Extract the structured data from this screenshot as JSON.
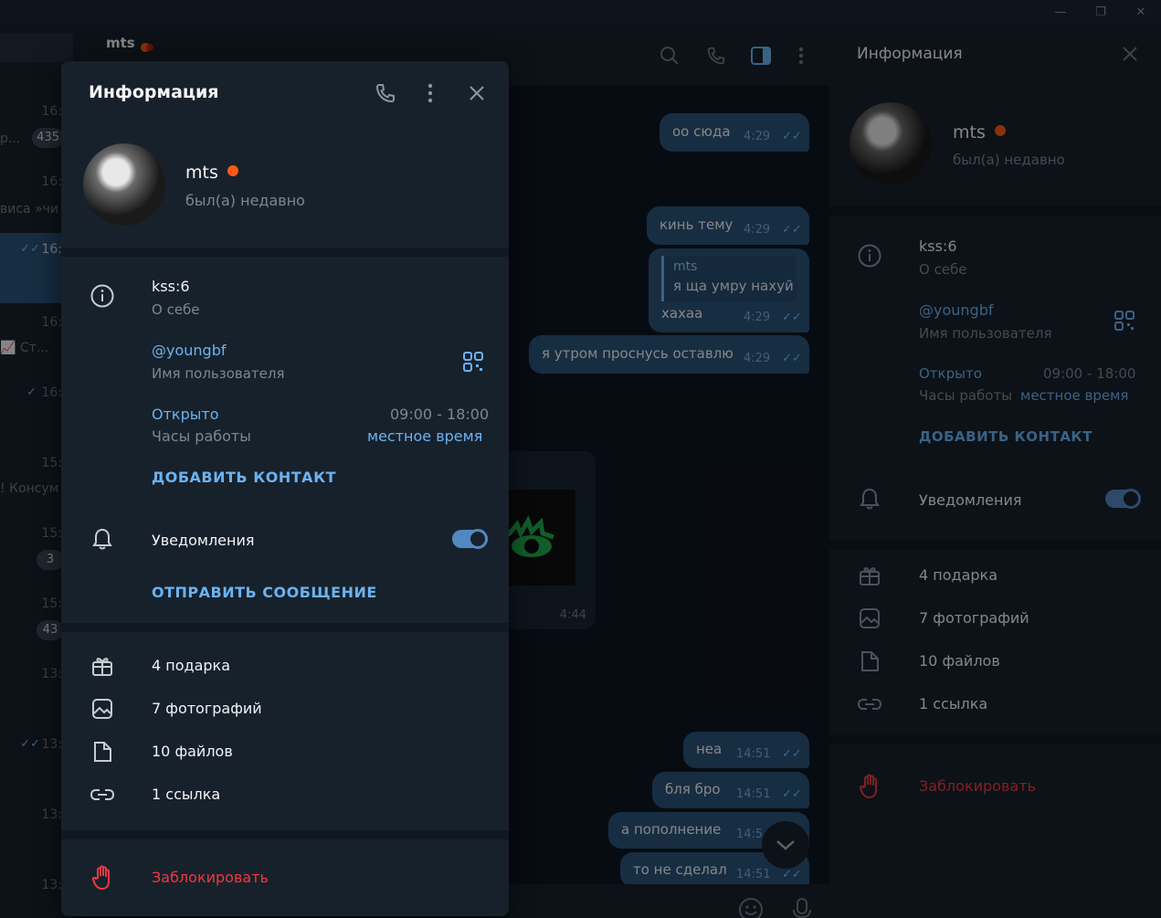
{
  "chat_list": {
    "rows": [
      {
        "time": "16:",
        "preview": "р...",
        "badge": "435"
      },
      {
        "time": "16:",
        "preview": "виса »чи",
        "badge": ""
      },
      {
        "time": "16:",
        "preview": "",
        "badge": ""
      },
      {
        "time": "16:",
        "preview": "📈 Ст...",
        "badge": ""
      },
      {
        "time": "16:",
        "preview": "",
        "badge": ""
      },
      {
        "time": "15:",
        "preview": "! Консум",
        "badge": ""
      },
      {
        "time": "15:",
        "preview": "",
        "badge": "3"
      },
      {
        "time": "15:",
        "preview": "",
        "badge": "43"
      },
      {
        "time": "13:",
        "preview": "",
        "badge": ""
      },
      {
        "time": "13:",
        "preview": "",
        "badge": ""
      },
      {
        "time": "13:",
        "preview": "",
        "badge": ""
      },
      {
        "time": "13:",
        "preview": "",
        "badge": ""
      }
    ]
  },
  "chat": {
    "title": "mts",
    "messages": [
      {
        "text": "оо сюда",
        "time": "4:29"
      },
      {
        "text": "кинь тему",
        "time": "4:29"
      },
      {
        "reply_name": "mts",
        "reply_text": "я ща умру нахуй",
        "text": "хахаа",
        "time": "4:29"
      },
      {
        "text": "я утром проснусь оставлю",
        "time": "4:29"
      },
      {
        "image_time": "4:44"
      },
      {
        "text": "неа",
        "time": "14:51"
      },
      {
        "text": "бля бро",
        "time": "14:51"
      },
      {
        "text": "а пополнение",
        "time": "14:5"
      },
      {
        "text": "то не сделал",
        "time": "14:51"
      }
    ]
  },
  "info": {
    "header": "Информация",
    "name": "mts",
    "status": "был(а) недавно",
    "bio": "kss:6",
    "bio_label": "О себе",
    "username": "@youngbf",
    "username_label": "Имя пользователя",
    "hours_status": "Открыто",
    "hours_range": "09:00 - 18:00",
    "hours_label": "Часы работы",
    "local_time": "местное время",
    "add_contact": "ДОБАВИТЬ КОНТАКТ",
    "notifications": "Уведомления",
    "notifications_on": true,
    "send_message": "ОТПРАВИТЬ СООБЩЕНИЕ",
    "gifts": "4 подарка",
    "photos": "7 фотографий",
    "files": "10 файлов",
    "links": "1 ссылка",
    "block": "Заблокировать"
  },
  "icons": {
    "minimize": "minimize-icon",
    "maximize": "maximize-icon",
    "close": "close-icon",
    "search": "search-icon",
    "phone": "phone-icon",
    "sidebar": "sidebar-toggle-icon",
    "more": "more-vertical-icon"
  },
  "colors": {
    "accent": "#6ab3f3",
    "bubble_out": "#2b5278",
    "panel": "#17212b",
    "background": "#0e1621",
    "danger": "#ec3942",
    "status_dot": "#ff5a14"
  }
}
